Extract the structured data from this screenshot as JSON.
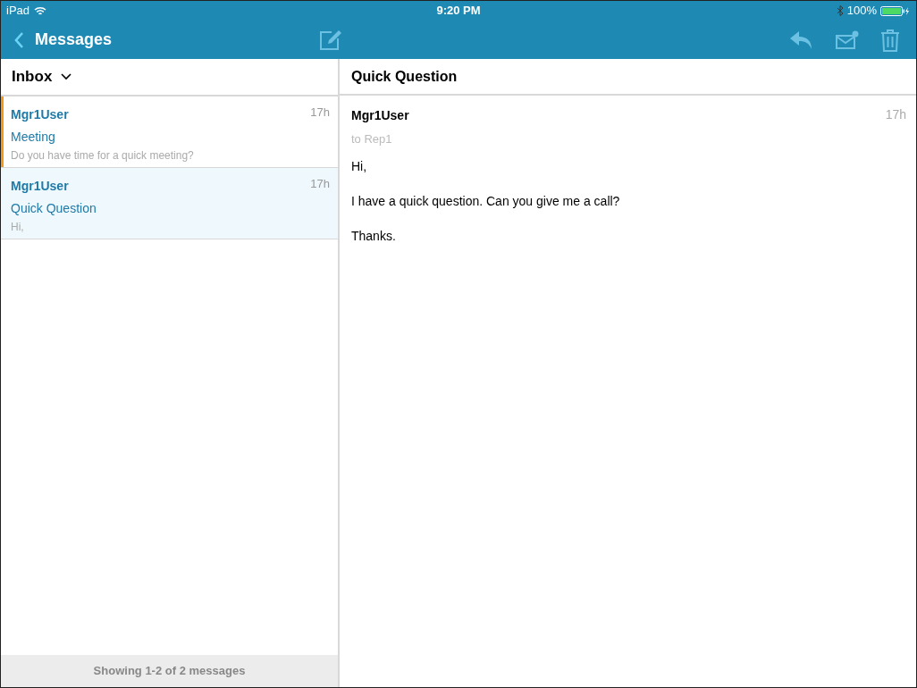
{
  "status_bar": {
    "device": "iPad",
    "time": "9:20 PM",
    "battery": "100%"
  },
  "nav": {
    "title": "Messages"
  },
  "folder": {
    "label": "Inbox"
  },
  "messages": [
    {
      "sender": "Mgr1User",
      "subject": "Meeting",
      "preview": "Do you have time for a quick meeting?",
      "time": "17h",
      "unread": true,
      "selected": false
    },
    {
      "sender": "Mgr1User",
      "subject": "Quick Question",
      "preview": "Hi,",
      "time": "17h",
      "unread": false,
      "selected": true
    }
  ],
  "footer": "Showing 1-2 of 2 messages",
  "detail": {
    "subject": "Quick Question",
    "sender": "Mgr1User",
    "recipient": "to Rep1",
    "time": "17h",
    "body": [
      "Hi,",
      "I have a quick question. Can you give me a call?",
      "Thanks."
    ]
  }
}
